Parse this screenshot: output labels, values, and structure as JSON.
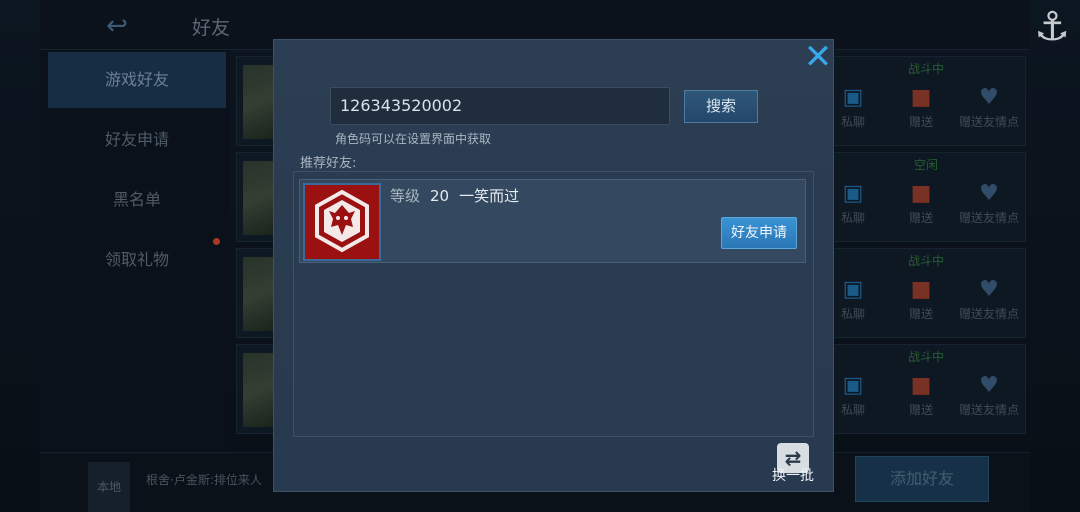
{
  "top": {
    "title": "好友"
  },
  "sidebar": {
    "items": [
      {
        "label": "游戏好友"
      },
      {
        "label": "好友申请"
      },
      {
        "label": "黑名单"
      },
      {
        "label": "领取礼物"
      }
    ]
  },
  "friend_rows": [
    {
      "status": "战斗中",
      "actions": [
        "私聊",
        "赠送",
        "赠送友情点"
      ]
    },
    {
      "status": "空闲",
      "actions": [
        "私聊",
        "赠送",
        "赠送友情点"
      ]
    },
    {
      "status": "战斗中",
      "actions": [
        "私聊",
        "赠送",
        "赠送友情点"
      ]
    },
    {
      "status": "战斗中",
      "actions": [
        "私聊",
        "赠送",
        "赠送友情点"
      ]
    }
  ],
  "bottom": {
    "local_tag": "本地",
    "chat_preview": "根舍·卢金斯:排位来人",
    "add_friend_label": "添加好友"
  },
  "modal": {
    "close_symbol": "✕",
    "search": {
      "value": "126343520002",
      "button_label": "搜索"
    },
    "hint": "角色码可以在设置界面中获取",
    "recommend_title": "推荐好友:",
    "recommend": {
      "level_label": "等级",
      "level": "20",
      "name": "一笑而过",
      "apply_label": "好友申请"
    },
    "refresh_label": "换一批"
  },
  "colors": {
    "accent": "#3aa7ec",
    "apply_button": "#2f84c4",
    "avatar_red": "#9b1010"
  },
  "icons": [
    "back-arrow-icon",
    "anchor-logo-icon",
    "close-icon",
    "chat-icon",
    "gift-icon",
    "heart-icon",
    "refresh-icon",
    "dragon-emblem-icon"
  ]
}
